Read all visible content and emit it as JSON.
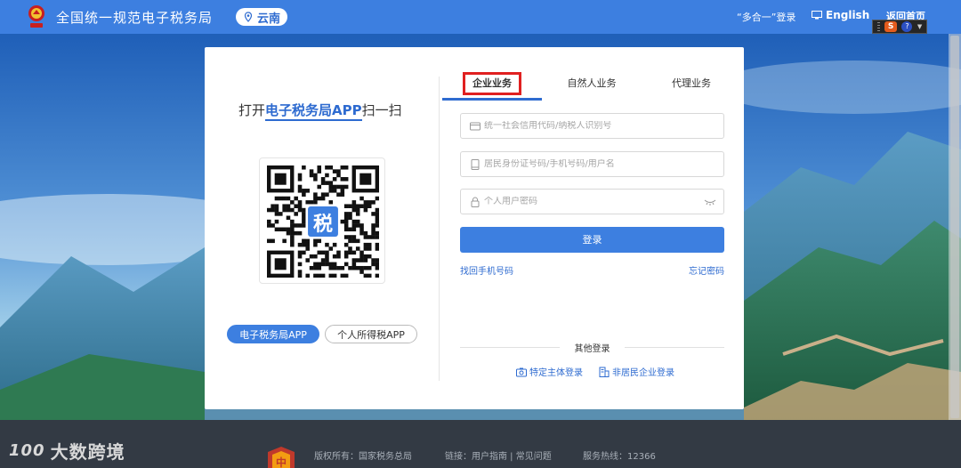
{
  "header": {
    "site_title": "全国统一规范电子税务局",
    "region": "云南",
    "multi_login": "“多合一”登录",
    "english": "English",
    "home": "返回首页"
  },
  "left_panel": {
    "scan_prefix": "打开",
    "scan_app": "电子税务局APP",
    "scan_suffix": "扫一扫",
    "qr_center": "税",
    "app_buttons": [
      "电子税务局APP",
      "个人所得税APP"
    ]
  },
  "tabs": [
    "企业业务",
    "自然人业务",
    "代理业务"
  ],
  "form": {
    "credit_code_placeholder": "统一社会信用代码/纳税人识别号",
    "id_placeholder": "居民身份证号码/手机号码/用户名",
    "password_placeholder": "个人用户密码",
    "login_button": "登录",
    "retrieve_phone": "找回手机号码",
    "forgot_password": "忘记密码"
  },
  "other_login": {
    "title": "其他登录",
    "links": [
      "特定主体登录",
      "非居民企业登录"
    ]
  },
  "footer": {
    "watermark": "大数跨境",
    "watermark_logo": "100",
    "copyright": "版权所有：国家税务总局",
    "links": "链接：用户指南 | 常见问题",
    "hotline": "服务热线：12366"
  },
  "colors": {
    "primary": "#3d7fe0",
    "highlight_box": "#e02020",
    "link": "#2e6bd0"
  }
}
